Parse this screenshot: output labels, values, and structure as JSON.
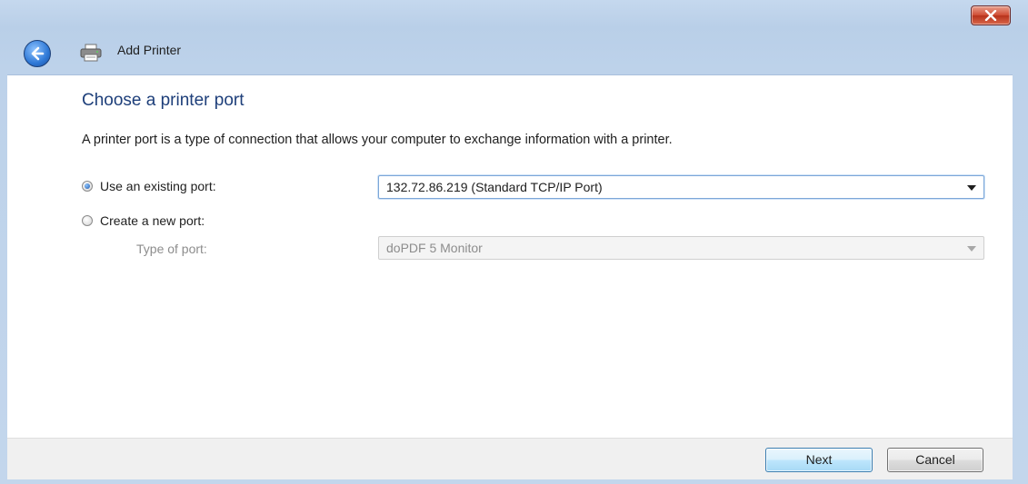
{
  "window": {
    "title": "Add Printer"
  },
  "page": {
    "heading": "Choose a printer port",
    "description": "A printer port is a type of connection that allows your computer to exchange information with a printer."
  },
  "options": {
    "existing_port_label": "Use an existing port:",
    "existing_port_selected": true,
    "existing_port_value": "132.72.86.219 (Standard TCP/IP Port)",
    "new_port_label": "Create a new port:",
    "new_port_selected": false,
    "type_of_port_label": "Type of port:",
    "type_of_port_value": "doPDF  5 Monitor"
  },
  "footer": {
    "next_label": "Next",
    "cancel_label": "Cancel"
  },
  "icons": {
    "close": "close-icon",
    "back": "back-arrow-icon",
    "printer": "printer-icon",
    "dropdown": "chevron-down-icon"
  },
  "colors": {
    "heading": "#1e3f7a",
    "close_button": "#cf4b32",
    "next_button_border": "#3c7fb1"
  }
}
